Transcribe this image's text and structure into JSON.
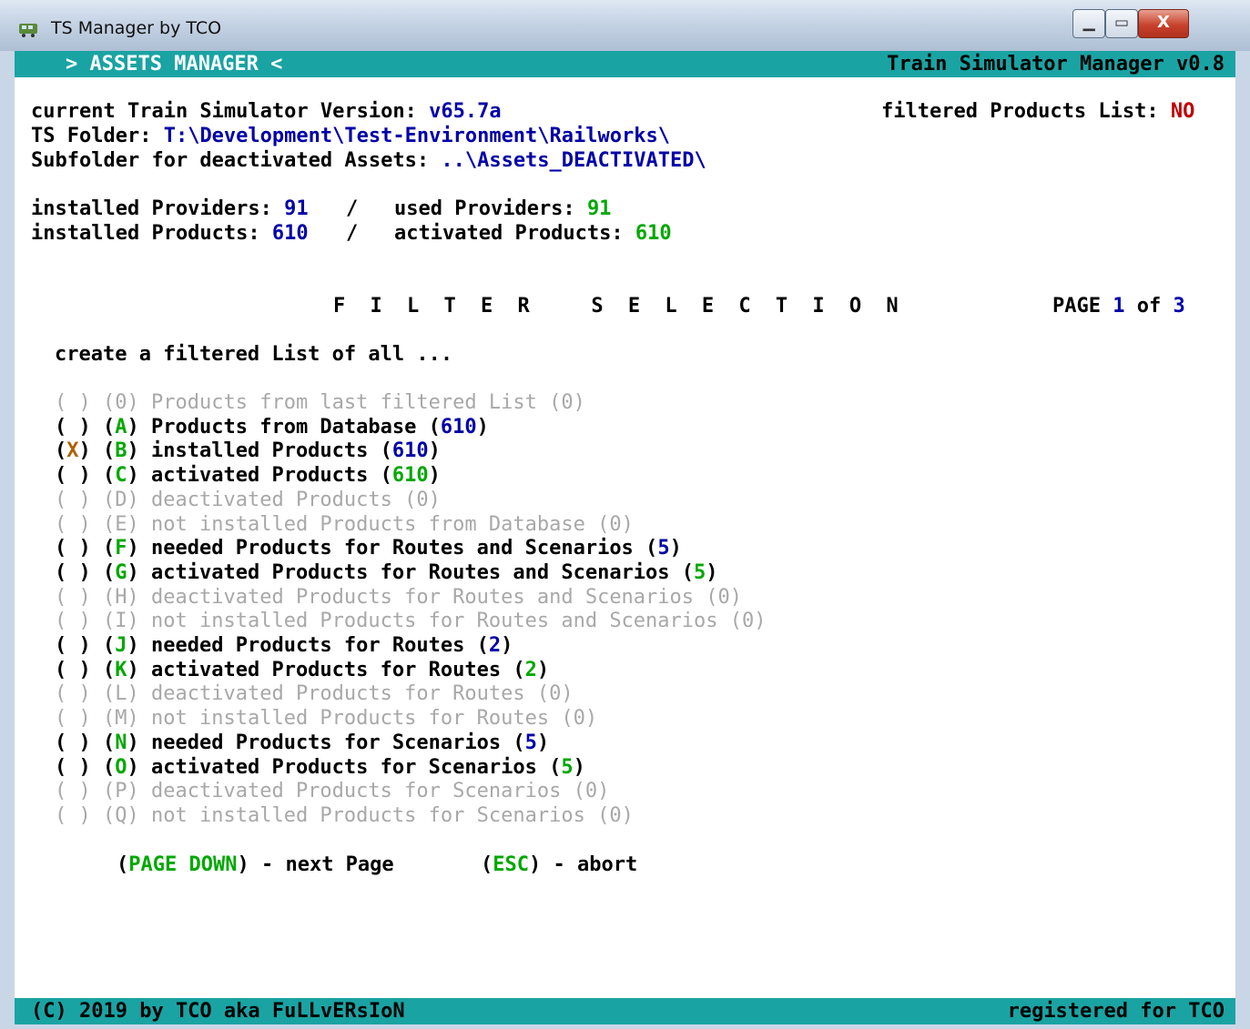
{
  "window": {
    "title": "TS Manager by TCO",
    "min_glyph": "▁",
    "max_glyph": "▭",
    "close_glyph": "X"
  },
  "header": {
    "section": "> ASSETS MANAGER <",
    "app_name": "Train Simulator Manager v0.8"
  },
  "info": {
    "version_label": "current Train Simulator Version:",
    "version_value": "v65.7a",
    "filtered_label": "filtered Products List:",
    "filtered_value": "NO",
    "folder_label": "TS Folder:",
    "folder_value": "T:\\Development\\Test-Environment\\Railworks\\",
    "subfolder_label": "Subfolder for deactivated Assets:",
    "subfolder_value": "..\\Assets_DEACTIVATED\\",
    "installed_providers_label": "installed Providers:",
    "installed_providers": "91",
    "used_providers_label": "used Providers:",
    "used_providers": "91",
    "installed_products_label": "installed Products:",
    "installed_products": "610",
    "activated_products_label": "activated Products:",
    "activated_products": "610",
    "separator": "/"
  },
  "filter": {
    "heading": "F I L T E R   S E L E C T I O N",
    "page_label": "PAGE",
    "page_current": "1",
    "page_of": "of",
    "page_total": "3",
    "intro": "create a filtered List of all ...",
    "options": [
      {
        "mark": " ",
        "key": "0",
        "text": "Products from last filtered List",
        "count": "0",
        "enabled": false,
        "count_color": "grey"
      },
      {
        "mark": " ",
        "key": "A",
        "text": "Products from Database",
        "count": "610",
        "enabled": true,
        "count_color": "blue"
      },
      {
        "mark": "X",
        "key": "B",
        "text": "installed Products",
        "count": "610",
        "enabled": true,
        "count_color": "blue"
      },
      {
        "mark": " ",
        "key": "C",
        "text": "activated Products",
        "count": "610",
        "enabled": true,
        "count_color": "green"
      },
      {
        "mark": " ",
        "key": "D",
        "text": "deactivated Products",
        "count": "0",
        "enabled": false,
        "count_color": "grey"
      },
      {
        "mark": " ",
        "key": "E",
        "text": "not installed Products from Database",
        "count": "0",
        "enabled": false,
        "count_color": "grey"
      },
      {
        "mark": " ",
        "key": "F",
        "text": "needed Products for Routes and Scenarios",
        "count": "5",
        "enabled": true,
        "count_color": "blue"
      },
      {
        "mark": " ",
        "key": "G",
        "text": "activated Products for Routes and Scenarios",
        "count": "5",
        "enabled": true,
        "count_color": "green"
      },
      {
        "mark": " ",
        "key": "H",
        "text": "deactivated Products for Routes and Scenarios",
        "count": "0",
        "enabled": false,
        "count_color": "grey"
      },
      {
        "mark": " ",
        "key": "I",
        "text": "not installed Products for Routes and Scenarios",
        "count": "0",
        "enabled": false,
        "count_color": "grey"
      },
      {
        "mark": " ",
        "key": "J",
        "text": "needed Products for Routes",
        "count": "2",
        "enabled": true,
        "count_color": "blue"
      },
      {
        "mark": " ",
        "key": "K",
        "text": "activated Products for Routes",
        "count": "2",
        "enabled": true,
        "count_color": "green"
      },
      {
        "mark": " ",
        "key": "L",
        "text": "deactivated Products for Routes",
        "count": "0",
        "enabled": false,
        "count_color": "grey"
      },
      {
        "mark": " ",
        "key": "M",
        "text": "not installed Products for Routes",
        "count": "0",
        "enabled": false,
        "count_color": "grey"
      },
      {
        "mark": " ",
        "key": "N",
        "text": "needed Products for Scenarios",
        "count": "5",
        "enabled": true,
        "count_color": "blue"
      },
      {
        "mark": " ",
        "key": "O",
        "text": "activated Products for Scenarios",
        "count": "5",
        "enabled": true,
        "count_color": "green"
      },
      {
        "mark": " ",
        "key": "P",
        "text": "deactivated Products for Scenarios",
        "count": "0",
        "enabled": false,
        "count_color": "grey"
      },
      {
        "mark": " ",
        "key": "Q",
        "text": "not installed Products for Scenarios",
        "count": "0",
        "enabled": false,
        "count_color": "grey"
      }
    ]
  },
  "actions": {
    "next_key": "PAGE DOWN",
    "next_text": "- next Page",
    "abort_key": "ESC",
    "abort_text": "- abort"
  },
  "footer": {
    "copyright": "(C) 2019 by TCO aka FuLLvERsIoN",
    "registered": "registered for TCO"
  },
  "colors": {
    "bar": "#1aa3a3",
    "blue": "#0000a8",
    "green": "#00a800",
    "red": "#c00000",
    "disabled": "#a8a8a8"
  }
}
